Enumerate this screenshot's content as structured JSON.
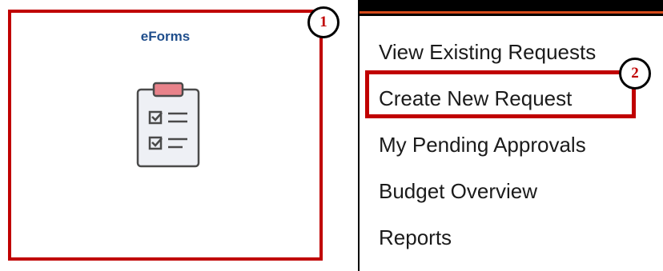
{
  "tile": {
    "title": "eForms",
    "icon": "clipboard-checklist-icon"
  },
  "callouts": {
    "step1": "1",
    "step2": "2"
  },
  "menu": {
    "items": [
      {
        "label": "View Existing Requests"
      },
      {
        "label": "Create New Request"
      },
      {
        "label": "My Pending Approvals"
      },
      {
        "label": "Budget Overview"
      },
      {
        "label": "Reports"
      }
    ]
  },
  "colors": {
    "highlight": "#c00000",
    "tile_title": "#1f4e8c",
    "topbar_accent": "#d64a1a",
    "clipboard_clip": "#e8828a",
    "clipboard_body": "#eef0f5"
  }
}
